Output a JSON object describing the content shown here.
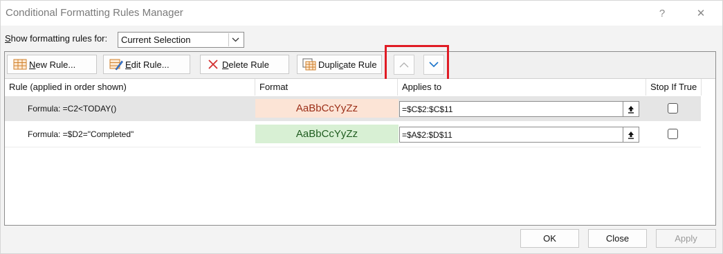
{
  "dialog": {
    "title": "Conditional Formatting Rules Manager",
    "help_label": "?",
    "close_label": "✕"
  },
  "show_rules": {
    "label_prefix": "S",
    "label_rest": "how formatting rules for:",
    "selected": "Current Selection"
  },
  "toolbar": {
    "new_rule_u": "N",
    "new_rule_rest": "ew Rule...",
    "edit_rule_u": "E",
    "edit_rule_rest": "dit Rule...",
    "delete_rule_u": "D",
    "delete_rule_rest": "elete Rule",
    "duplicate_pre": "Dupli",
    "duplicate_u": "c",
    "duplicate_post": "ate Rule"
  },
  "columns": {
    "rule": "Rule (applied in order shown)",
    "format": "Format",
    "applies_to": "Applies to",
    "stop_if_true": "Stop If True"
  },
  "rules": [
    {
      "rule": "Formula: =C2<TODAY()",
      "format_preview": "AaBbCcYyZz",
      "format_bg": "#fce4d6",
      "format_color": "#9c2f18",
      "applies_to": "=$C$2:$C$11",
      "stop_if_true": false,
      "selected": true
    },
    {
      "rule": "Formula: =$D2=\"Completed\"",
      "format_preview": "AaBbCcYyZz",
      "format_bg": "#d8f0d4",
      "format_color": "#1f5c1f",
      "applies_to": "=$A$2:$D$11",
      "stop_if_true": false,
      "selected": false
    }
  ],
  "footer": {
    "ok": "OK",
    "close": "Close",
    "apply": "Apply"
  },
  "colors": {
    "highlight_box": "#e01b24",
    "arrow_down": "#1a73c9"
  }
}
